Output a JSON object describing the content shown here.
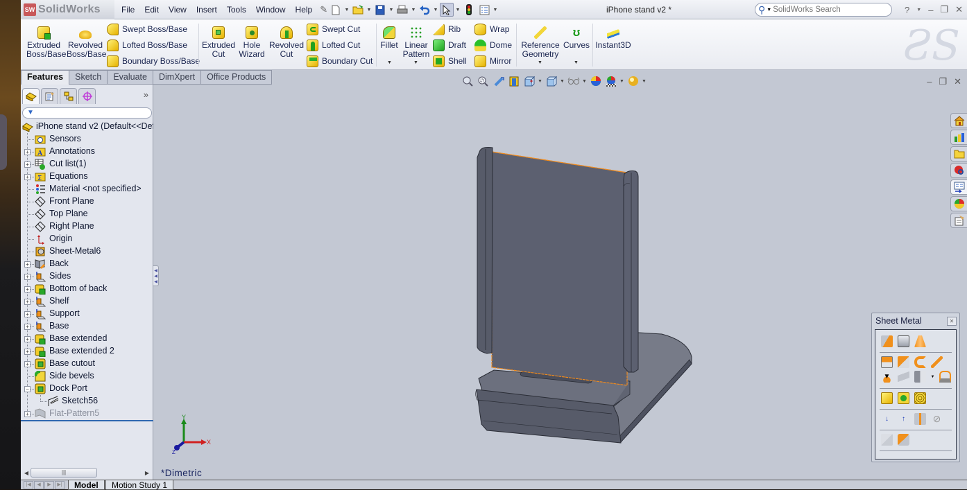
{
  "app": {
    "brand": "SolidWorks",
    "brand_badge": "SW",
    "document_title": "iPhone stand v2 *"
  },
  "menu": [
    "File",
    "Edit",
    "View",
    "Insert",
    "Tools",
    "Window",
    "Help"
  ],
  "search": {
    "placeholder": "SolidWorks Search"
  },
  "window_controls": {
    "help": "?",
    "minimize": "–",
    "restore": "❐",
    "close": "✕"
  },
  "command_manager": {
    "large_buttons": [
      {
        "id": "extruded-boss",
        "label": "Extruded\nBoss/Base"
      },
      {
        "id": "revolved-boss",
        "label": "Revolved\nBoss/Base"
      },
      {
        "id": "extruded-cut",
        "label": "Extruded\nCut"
      },
      {
        "id": "hole-wizard",
        "label": "Hole\nWizard"
      },
      {
        "id": "revolved-cut",
        "label": "Revolved\nCut"
      },
      {
        "id": "fillet",
        "label": "Fillet"
      },
      {
        "id": "linear-pattern",
        "label": "Linear\nPattern"
      },
      {
        "id": "reference-geometry",
        "label": "Reference\nGeometry"
      },
      {
        "id": "curves",
        "label": "Curves"
      },
      {
        "id": "instant3d",
        "label": "Instant3D"
      }
    ],
    "small_buttons": {
      "boss": [
        "Swept Boss/Base",
        "Lofted Boss/Base",
        "Boundary Boss/Base"
      ],
      "cut": [
        "Swept Cut",
        "Lofted Cut",
        "Boundary Cut"
      ],
      "col1": [
        "Rib",
        "Draft",
        "Shell"
      ],
      "col2": [
        "Wrap",
        "Dome",
        "Mirror"
      ]
    },
    "tabs": [
      "Features",
      "Sketch",
      "Evaluate",
      "DimXpert",
      "Office Products"
    ],
    "active_tab": "Features"
  },
  "feature_manager": {
    "filter_icon": "filter-icon",
    "root": "iPhone stand v2  (Default<<Def",
    "items": [
      {
        "label": "Sensors",
        "icon": "sensor-folder-icon",
        "expandable": false
      },
      {
        "label": "Annotations",
        "icon": "annotations-folder-icon",
        "expandable": true
      },
      {
        "label": "Cut list(1)",
        "icon": "cut-list-icon",
        "expandable": true
      },
      {
        "label": "Equations",
        "icon": "equations-folder-icon",
        "expandable": true
      },
      {
        "label": "Material <not specified>",
        "icon": "material-icon",
        "expandable": false
      },
      {
        "label": "Front Plane",
        "icon": "plane-icon",
        "expandable": false
      },
      {
        "label": "Top Plane",
        "icon": "plane-icon",
        "expandable": false
      },
      {
        "label": "Right Plane",
        "icon": "plane-icon",
        "expandable": false
      },
      {
        "label": "Origin",
        "icon": "origin-icon",
        "expandable": false
      },
      {
        "label": "Sheet-Metal6",
        "icon": "sheet-metal-icon",
        "expandable": false
      },
      {
        "label": "Back",
        "icon": "base-flange-icon",
        "expandable": true
      },
      {
        "label": "Sides",
        "icon": "edge-flange-icon",
        "expandable": true
      },
      {
        "label": "Bottom of back",
        "icon": "extrude-icon",
        "expandable": true
      },
      {
        "label": "Shelf",
        "icon": "edge-flange-icon",
        "expandable": true
      },
      {
        "label": "Support",
        "icon": "edge-flange-icon",
        "expandable": true
      },
      {
        "label": "Base",
        "icon": "edge-flange-icon",
        "expandable": true
      },
      {
        "label": "Base extended",
        "icon": "extrude-icon",
        "expandable": true
      },
      {
        "label": "Base extended 2",
        "icon": "extrude-icon",
        "expandable": true
      },
      {
        "label": "Base cutout",
        "icon": "cut-extrude-icon",
        "expandable": true
      },
      {
        "label": "Side bevels",
        "icon": "fillet-icon",
        "expandable": false
      },
      {
        "label": "Dock Port",
        "icon": "cut-extrude-icon",
        "expandable": true,
        "expanded": true
      },
      {
        "label": "Sketch56",
        "icon": "sketch-icon",
        "expandable": false,
        "child": true
      },
      {
        "label": "Flat-Pattern5",
        "icon": "flat-pattern-icon",
        "expandable": true,
        "suppressed": true
      }
    ]
  },
  "graphics": {
    "view_orientation": "*Dimetric",
    "triad": {
      "x": "X",
      "y": "Y",
      "z": "Z"
    },
    "highlight_color": "#f08a1c",
    "model_color": "#5c6070"
  },
  "sheet_metal_toolbar": {
    "title": "Sheet Metal"
  },
  "bottom_tabs": [
    "Model",
    "Motion Study 1"
  ],
  "active_bottom_tab": "Model"
}
